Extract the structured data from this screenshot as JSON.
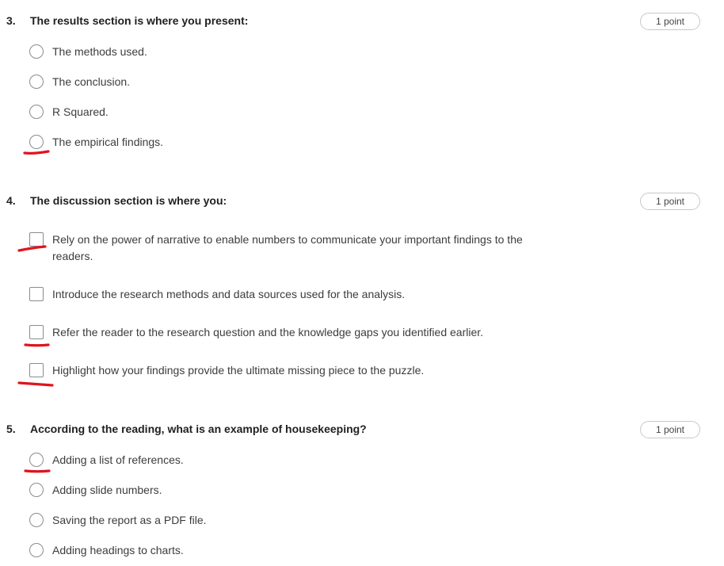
{
  "questions": [
    {
      "number": "3.",
      "text": "The results section is where you present:",
      "points": "1 point",
      "options": [
        "The methods used.",
        "The conclusion.",
        "R Squared.",
        "The empirical findings."
      ]
    },
    {
      "number": "4.",
      "text": "The discussion section is where you:",
      "points": "1 point",
      "options": [
        "Rely on the power of narrative to enable numbers to communicate your important findings to the readers.",
        "Introduce the research methods and data sources used for the analysis.",
        "Refer the reader to the research question and the knowledge gaps you identified earlier.",
        "Highlight how your findings provide the ultimate missing piece to the puzzle."
      ]
    },
    {
      "number": "5.",
      "text": "According to the reading, what is an example of housekeeping?",
      "points": "1 point",
      "options": [
        "Adding a list of references.",
        "Adding slide numbers.",
        "Saving the report as a PDF file.",
        "Adding headings to charts."
      ]
    }
  ],
  "colors": {
    "annotation_mark": "#e0141e",
    "control_border": "#8c8c8c"
  }
}
